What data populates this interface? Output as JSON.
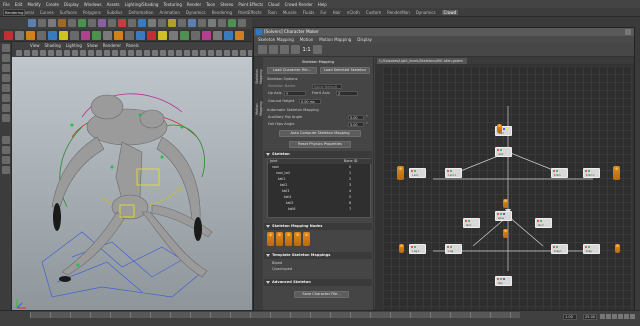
{
  "menubar": [
    "File",
    "Edit",
    "Modify",
    "Create",
    "Display",
    "Windows",
    "Assets",
    "Lighting/Shading",
    "Texturing",
    "Render",
    "Toon",
    "Stereo",
    "Paint Effects",
    "Cloud",
    "Crowd Render",
    "Help"
  ],
  "mode_select": "Rendering",
  "shelf_tabs": [
    "General",
    "Curves",
    "Surfaces",
    "Polygons",
    "Subdivs",
    "Deformation",
    "Animation",
    "Dynamics",
    "Rendering",
    "PaintEffects",
    "Toon",
    "Muscle",
    "Fluids",
    "Fur",
    "Hair",
    "nCloth",
    "Custom",
    "RenderMan",
    "Dynamics",
    "Crowd"
  ],
  "selected_shelf_tab": "Crowd",
  "viewport_menu": [
    "View",
    "Shading",
    "Lighting",
    "Show",
    "Renderer",
    "Panels"
  ],
  "hik": {
    "window_title": "[Solvers] Character Maker",
    "menu": [
      "Skeleton Mapping",
      "Motion",
      "Motion Mapping",
      "Display"
    ],
    "toolbar_label": "1:1",
    "side_tabs": [
      "Skeleton Mapping",
      "Motion Mapping"
    ],
    "section_title": "Skeleton Mapping",
    "load_character_btn": "Load Character File...",
    "load_selected_btn": "Load Selected Skeleton",
    "skeleton_options_label": "Skeleton Options",
    "skeleton_name_label": "Skeleton Name",
    "skeleton_name_value": "Spine Default",
    "up_axis_label": "Up Axis",
    "up_axis_value": "Y",
    "front_axis_label": "Front Axis",
    "front_axis_value": "Z",
    "ground_height_label": "Ground Height",
    "ground_height_value": "0.00 ms",
    "auto_mapping_label": "Automatic Skeleton Mapping",
    "aux_hip_label": "Auxiliary Hip Angle",
    "aux_hip_value": "5.00",
    "aux_hip_unit": "°",
    "foil_hips_label": "Foil Hips Angle",
    "foil_hips_value": "5.00",
    "foil_hips_unit": "°",
    "auto_compute_btn": "Auto Compute Skeleton Mapping",
    "reset_physics_btn": "Reset Physics Properties",
    "skeleton_header": "Skeleton",
    "table_headers": [
      "Joint",
      "Bone ID"
    ],
    "table_rows": [
      {
        "name": "root",
        "val": "0"
      },
      {
        "name": "root_tail",
        "val": "1"
      },
      {
        "name": "tail1",
        "val": "2"
      },
      {
        "name": "tail2",
        "val": "3"
      },
      {
        "name": "tail3",
        "val": "4"
      },
      {
        "name": "tail4",
        "val": "5"
      },
      {
        "name": "tail5",
        "val": "6"
      },
      {
        "name": "tail6",
        "val": "7"
      }
    ],
    "mapping_nodes_header": "Skeleton Mapping Nodes",
    "templates_header": "Template Skeleton Mappings",
    "templates": [
      "Biped",
      "Quadruped"
    ],
    "advanced_header": "Advanced Skeleton",
    "save_btn": "Save Character File...",
    "file_tab": "C:/Episodes/Light_levels/Skeletons/HIK alien.golem",
    "node_labels": [
      "head",
      "neck",
      "spine",
      "hips",
      "L arm",
      "L arm 1",
      "R arm",
      "R arm 1",
      "L leg 1",
      "L leg",
      "R leg 1",
      "R leg",
      "tail 1",
      "tail 2"
    ]
  },
  "timeline": {
    "start": "1.00",
    "end": "25.00"
  }
}
